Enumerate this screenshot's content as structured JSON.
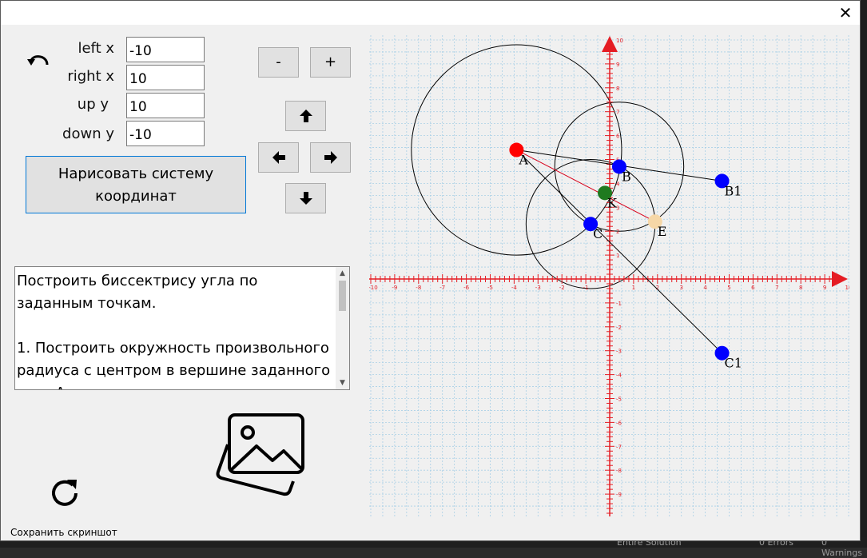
{
  "window": {
    "close_label": "✕"
  },
  "fields": [
    {
      "label": "left x",
      "value": "-10"
    },
    {
      "label": "right x",
      "value": "10"
    },
    {
      "label": "up y",
      "value": "10"
    },
    {
      "label": "down y",
      "value": "-10"
    }
  ],
  "zoom": {
    "minus": "-",
    "plus": "+"
  },
  "draw_button": {
    "line1": "Нарисовать систему",
    "line2": "координат"
  },
  "instructions": "Построить биссектрису угла по заданным точкам.\n\n1. Построить окружность произвольного радиуса с центром в вершине заданного угла А.",
  "status": {
    "save_label": "Сохранить скриншот"
  },
  "ide": {
    "solution": "Entire Solution",
    "errors": "0 Errors",
    "warnings": "0 Warnings"
  },
  "icons": {
    "undo": "undo-icon",
    "redo": "redo-icon",
    "image": "image-icon",
    "up": "arrow-up-icon",
    "down": "arrow-down-icon",
    "left": "arrow-left-icon",
    "right": "arrow-right-icon"
  },
  "colors": {
    "axis": "#e51c23",
    "grid": "#a9cfe6",
    "point_blue": "#0000ff",
    "point_red": "#ff0000",
    "point_green": "#1f7a1f",
    "point_e": "#f6d7a7",
    "bisector": "#d8001a"
  },
  "graph": {
    "xlim": [
      -10,
      10
    ],
    "ylim": [
      -10,
      10
    ],
    "x_ticks": [
      "-10",
      "-9",
      "-8",
      "-7",
      "-6",
      "-5",
      "-4",
      "-3",
      "-2",
      "-1",
      "1",
      "2",
      "3",
      "4",
      "5",
      "6",
      "7",
      "8",
      "9",
      "10"
    ],
    "y_ticks": [
      "-9",
      "-8",
      "-7",
      "-6",
      "-5",
      "-4",
      "-3",
      "-2",
      "-1",
      "1",
      "2",
      "3",
      "4",
      "5",
      "6",
      "7",
      "8",
      "9",
      "10"
    ],
    "points": [
      {
        "name": "A",
        "x": -3.9,
        "y": 5.4,
        "color": "red"
      },
      {
        "name": "B",
        "x": 0.4,
        "y": 4.7,
        "color": "blue"
      },
      {
        "name": "B1",
        "x": 4.7,
        "y": 4.1,
        "color": "blue"
      },
      {
        "name": "C",
        "x": -0.8,
        "y": 2.3,
        "color": "blue"
      },
      {
        "name": "C1",
        "x": 4.7,
        "y": -3.1,
        "color": "blue"
      },
      {
        "name": "K",
        "x": -0.2,
        "y": 3.6,
        "color": "green"
      },
      {
        "name": "E",
        "x": 1.9,
        "y": 2.4,
        "color": "e"
      }
    ],
    "segments": [
      {
        "from": "A",
        "to": "B1"
      },
      {
        "from": "A",
        "to": "C1"
      },
      {
        "from": "A",
        "to": "E",
        "bisector": true
      }
    ],
    "circles": [
      {
        "cx": -3.9,
        "cy": 5.4,
        "r": 4.4
      },
      {
        "cx": 0.4,
        "cy": 4.7,
        "r": 2.7
      },
      {
        "cx": -0.8,
        "cy": 2.3,
        "r": 2.7
      }
    ]
  }
}
